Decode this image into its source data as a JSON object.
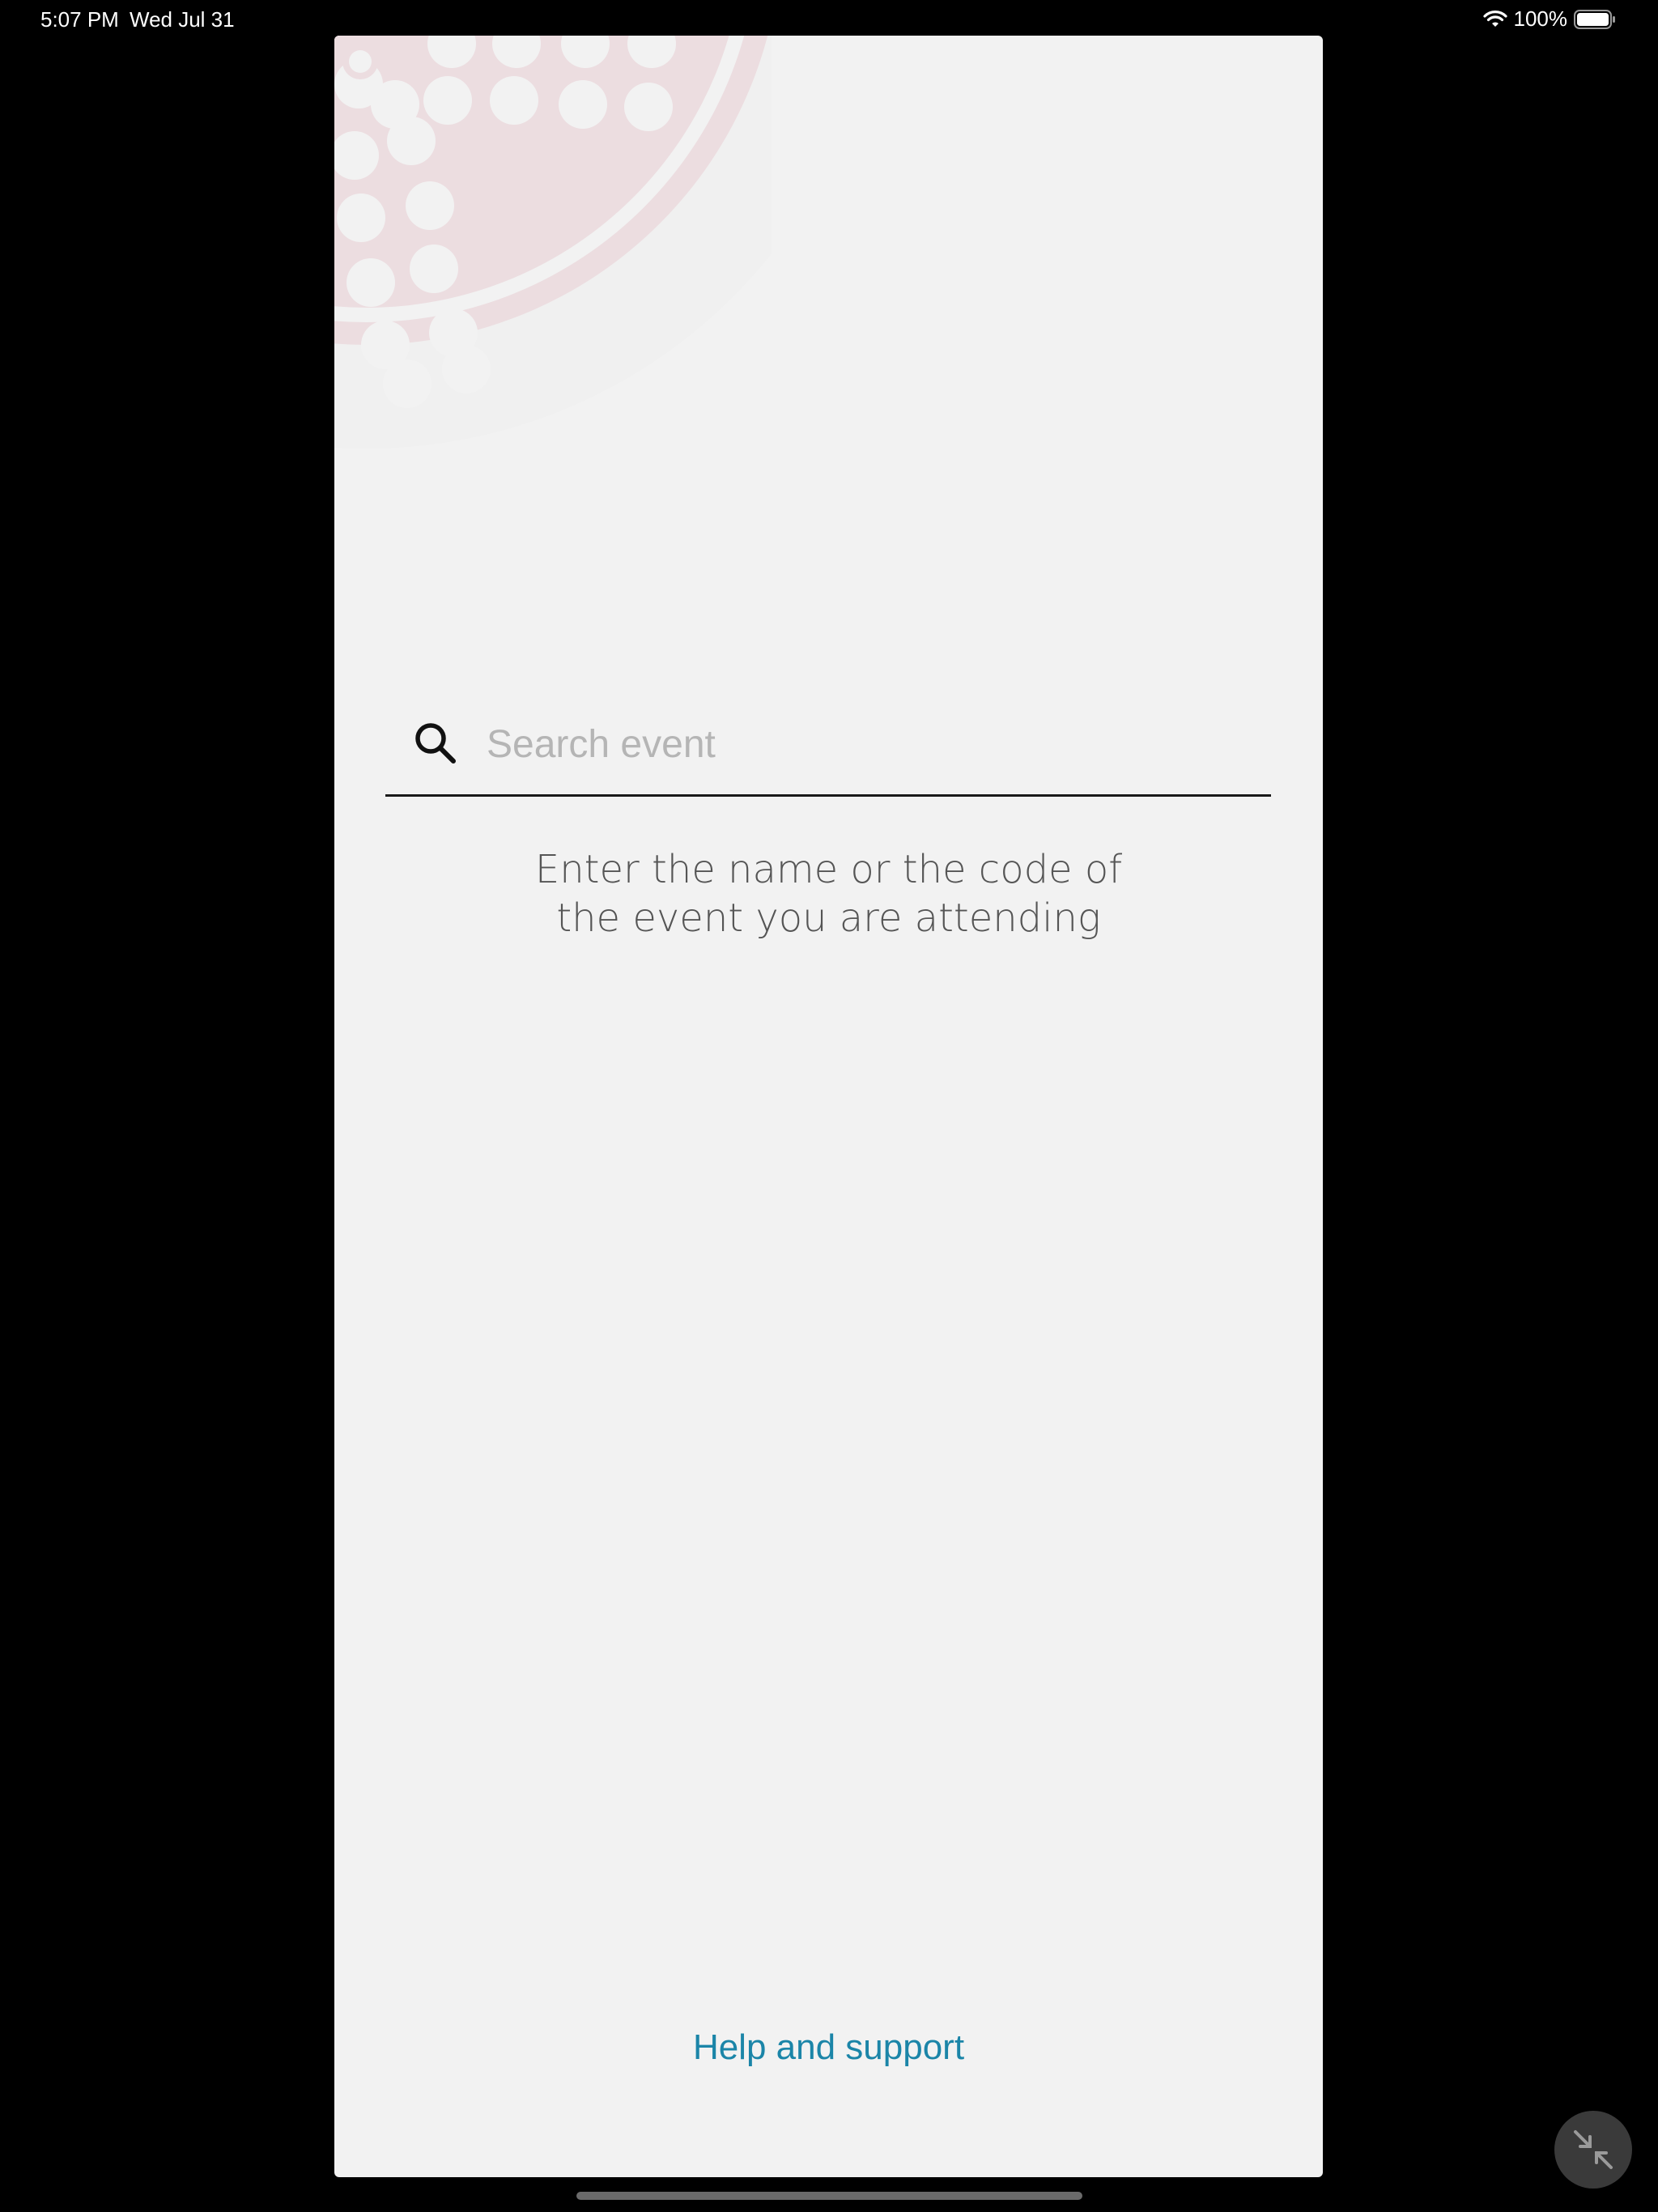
{
  "status_bar": {
    "time": "5:07 PM",
    "date": "Wed Jul 31",
    "battery": "100%",
    "icons": [
      "wifi-icon",
      "battery-icon"
    ]
  },
  "search": {
    "placeholder": "Search event",
    "value": "",
    "icon": "search-icon"
  },
  "hint": {
    "line1": "Enter the name or the code of",
    "line2": "the event you are attending"
  },
  "help": {
    "label": "Help and support"
  },
  "floating_button": {
    "icon": "minimize-arrows-icon"
  },
  "colors": {
    "app_background": "#f2f2f2",
    "decor_pink": "#ecdde0",
    "link": "#1b85a8",
    "placeholder": "#b5b5b5",
    "hint_text": "#555555"
  }
}
